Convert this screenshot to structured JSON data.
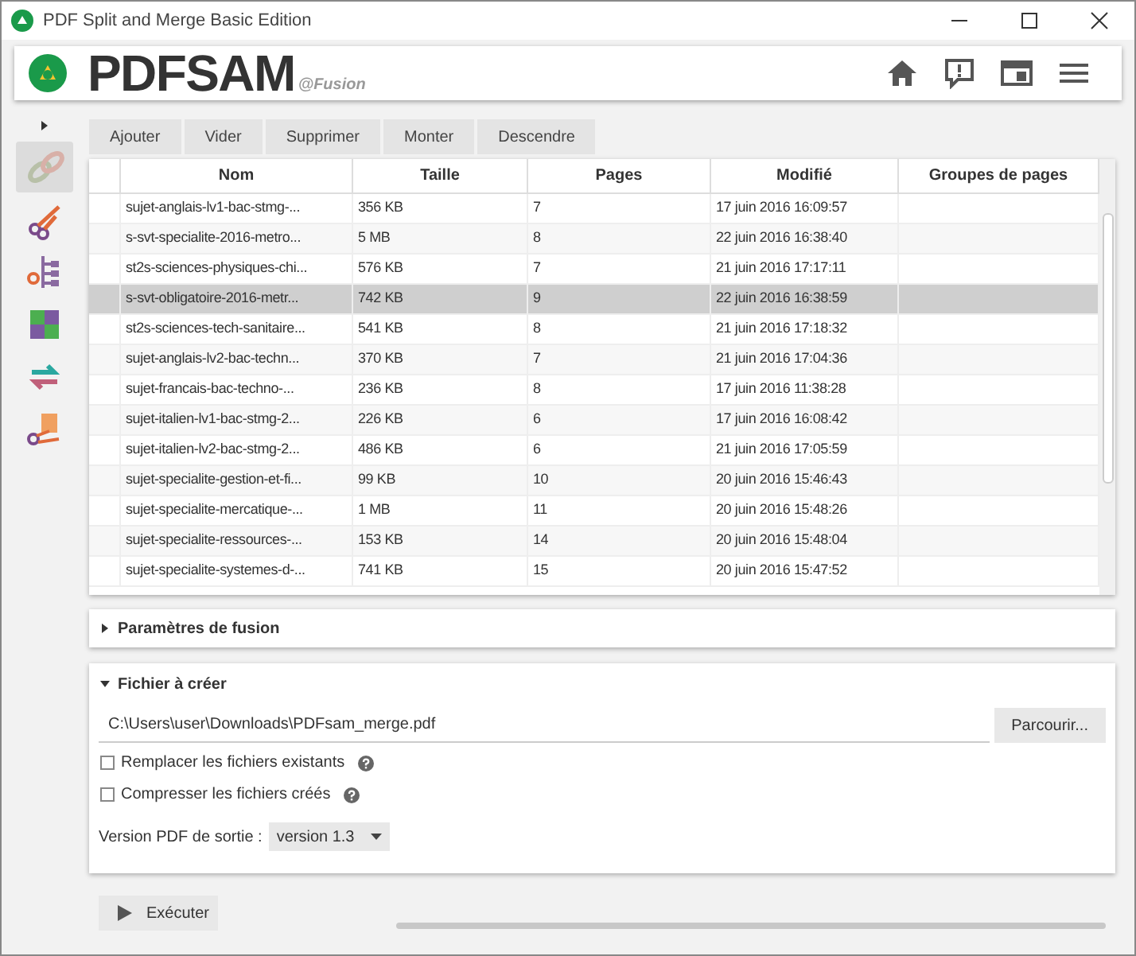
{
  "window": {
    "title": "PDF Split and Merge Basic Edition"
  },
  "header": {
    "logo_main": "PDFSAM",
    "logo_sub": "@Fusion"
  },
  "sidebar": {
    "items": [
      {
        "kind": "merge",
        "selected": true
      },
      {
        "kind": "split",
        "selected": false
      },
      {
        "kind": "splitbookmarks",
        "selected": false
      },
      {
        "kind": "mix",
        "selected": false
      },
      {
        "kind": "rotate",
        "selected": false
      },
      {
        "kind": "extract",
        "selected": false
      }
    ]
  },
  "toolbar": [
    "Ajouter",
    "Vider",
    "Supprimer",
    "Monter",
    "Descendre"
  ],
  "table": {
    "columns": [
      "Nom",
      "Taille",
      "Pages",
      "Modifié",
      "Groupes de pages"
    ],
    "rows": [
      {
        "cells": [
          "sujet-anglais-lv1-bac-stmg-...",
          "356 KB",
          "7",
          "17 juin 2016 16:09:57"
        ],
        "selected": false
      },
      {
        "cells": [
          "s-svt-specialite-2016-metro...",
          "5 MB",
          "8",
          "22 juin 2016 16:38:40"
        ],
        "selected": false
      },
      {
        "cells": [
          "st2s-sciences-physiques-chi...",
          "576 KB",
          "7",
          "21 juin 2016 17:17:11"
        ],
        "selected": false
      },
      {
        "cells": [
          "s-svt-obligatoire-2016-metr...",
          "742 KB",
          "9",
          "22 juin 2016 16:38:59"
        ],
        "selected": true
      },
      {
        "cells": [
          "st2s-sciences-tech-sanitaire...",
          "541 KB",
          "8",
          "21 juin 2016 17:18:32"
        ],
        "selected": false
      },
      {
        "cells": [
          "sujet-anglais-lv2-bac-techn...",
          "370 KB",
          "7",
          "21 juin 2016 17:04:36"
        ],
        "selected": false
      },
      {
        "cells": [
          "sujet-francais-bac-techno-...",
          "236 KB",
          "8",
          "17 juin 2016 11:38:28"
        ],
        "selected": false
      },
      {
        "cells": [
          "sujet-italien-lv1-bac-stmg-2...",
          "226 KB",
          "6",
          "17 juin 2016 16:08:42"
        ],
        "selected": false
      },
      {
        "cells": [
          "sujet-italien-lv2-bac-stmg-2...",
          "486 KB",
          "6",
          "21 juin 2016 17:05:59"
        ],
        "selected": false
      },
      {
        "cells": [
          "sujet-specialite-gestion-et-fi...",
          "99 KB",
          "10",
          "20 juin 2016 15:46:43"
        ],
        "selected": false
      },
      {
        "cells": [
          "sujet-specialite-mercatique-...",
          "1 MB",
          "11",
          "20 juin 2016 15:48:26"
        ],
        "selected": false
      },
      {
        "cells": [
          "sujet-specialite-ressources-...",
          "153 KB",
          "14",
          "20 juin 2016 15:48:04"
        ],
        "selected": false
      },
      {
        "cells": [
          "sujet-specialite-systemes-d-...",
          "741 KB",
          "15",
          "20 juin 2016 15:47:52"
        ],
        "selected": false
      }
    ]
  },
  "merge_settings": {
    "title": "Paramètres de fusion",
    "expanded": false
  },
  "output": {
    "title": "Fichier à créer",
    "expanded": true,
    "path": "C:\\Users\\user\\Downloads\\PDFsam_merge.pdf",
    "browse": "Parcourir...",
    "options": [
      {
        "label": "Remplacer les fichiers existants",
        "checked": false
      },
      {
        "label": "Compresser les fichiers créés",
        "checked": false
      }
    ],
    "version_label": "Version PDF de sortie :",
    "version": "version 1.3"
  },
  "run_button": "Exécuter",
  "progress": {
    "level": 0
  }
}
